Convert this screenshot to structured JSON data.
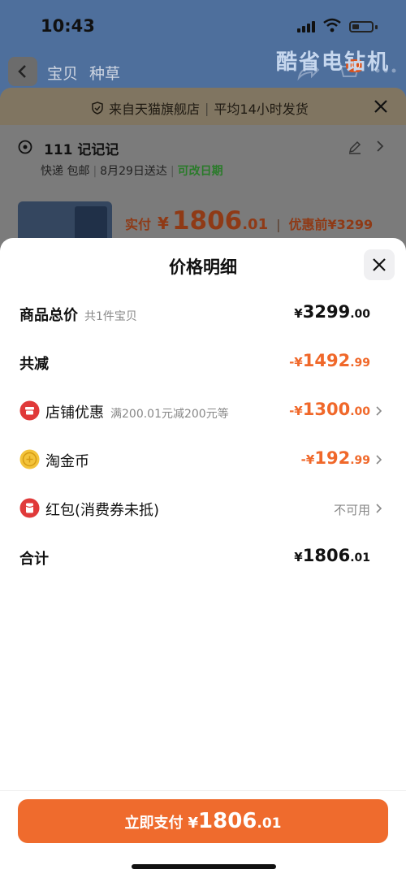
{
  "status_bar": {
    "time": "10:43"
  },
  "background": {
    "nav_tabs": [
      "宝贝",
      "种草"
    ],
    "banner_text": "酷省电钻机",
    "cart_count": "10",
    "store_bar": {
      "text": "来自天猫旗舰店",
      "avg_ship": "平均14小时发货"
    },
    "address": {
      "name": "111 记记记",
      "delivery": "快递 包邮",
      "date": "8月29日送达",
      "change_date": "可改日期"
    },
    "paid": {
      "label": "实付",
      "currency": "¥",
      "int": "1806",
      "dec": ".01",
      "before_label": "优惠前",
      "before_value": "¥3299"
    }
  },
  "sheet": {
    "title": "价格明细",
    "rows": [
      {
        "label": "商品总价",
        "sub": "共1件宝贝",
        "cur": "¥",
        "int": "3299",
        "dec": ".00"
      },
      {
        "label": "共减",
        "cur": "-¥",
        "int": "1492",
        "dec": ".99"
      },
      {
        "label": "店铺优惠",
        "sub": "满200.01元减200元等",
        "cur": "-¥",
        "int": "1300",
        "dec": ".00"
      },
      {
        "label": "淘金币",
        "cur": "-¥",
        "int": "192",
        "dec": ".99"
      },
      {
        "label": "红包(消费券未抵)",
        "status": "不可用"
      },
      {
        "label": "合计",
        "cur": "¥",
        "int": "1806",
        "dec": ".01"
      }
    ],
    "pay_button": {
      "label": "立即支付",
      "cur": "¥",
      "int": "1806",
      "dec": ".01"
    }
  },
  "colors": {
    "accent": "#ef6b2d",
    "discount": "#f0682a",
    "red_icon": "#e03a3a",
    "coin": "#f3c33a"
  }
}
